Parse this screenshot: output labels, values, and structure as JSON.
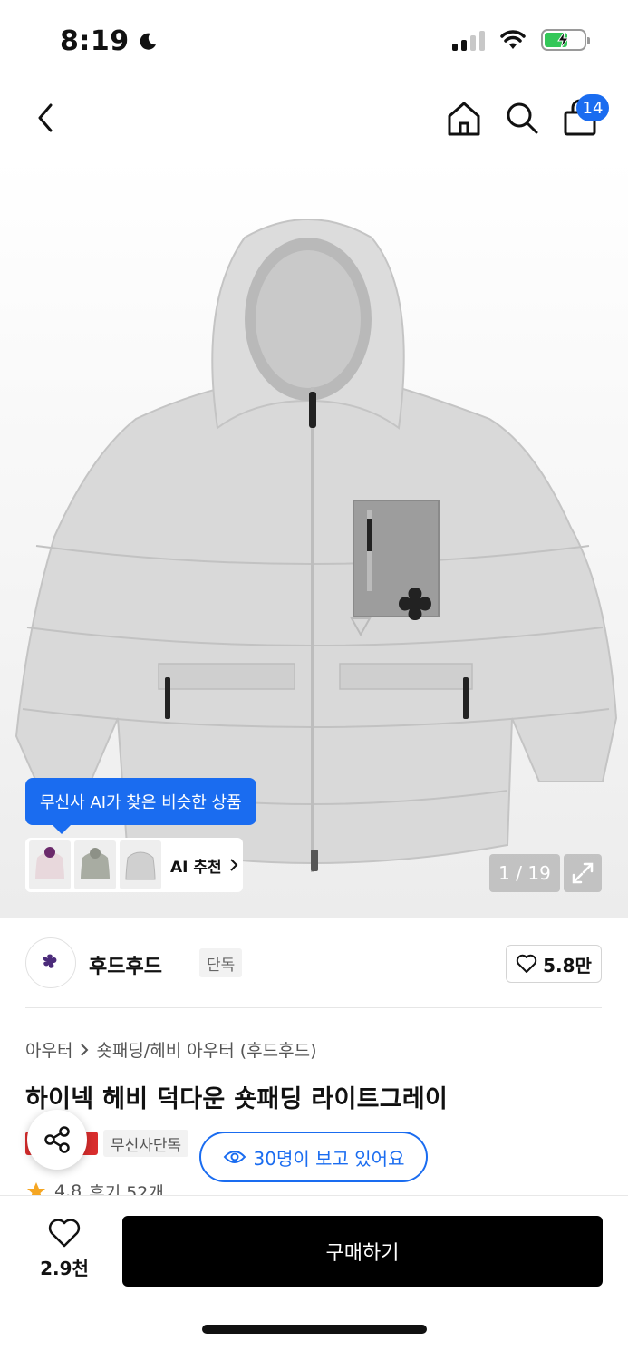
{
  "status_bar": {
    "time": "8:19",
    "moon_icon": "moon-icon",
    "wifi_icon": "wifi-icon",
    "battery_icon": "battery-charging-icon"
  },
  "top_nav": {
    "back_icon": "chevron-left-icon",
    "home_icon": "home-icon",
    "search_icon": "search-icon",
    "cart_icon": "shopping-bag-icon",
    "cart_count": "14"
  },
  "gallery": {
    "ai_tooltip": "무신사 AI가 찾은 비슷한 상품",
    "ai_reco_label": "AI 추천",
    "page_counter": "1 / 19"
  },
  "brand": {
    "name": "후드후드",
    "tag": "단독",
    "likes": "5.8만"
  },
  "product": {
    "breadcrumb": [
      "아우터",
      "숏패딩/헤비 아우터 (후드후드)"
    ],
    "title": "하이넥 헤비 덕다운 숏패딩 라이트그레이",
    "exclusive_badge": "무신사단독",
    "viewers": "30명이 보고 있어요",
    "rating": "4.8",
    "reviews": "후기 52개"
  },
  "bottom_bar": {
    "wish_count": "2.9천",
    "buy_label": "구매하기"
  },
  "colors": {
    "accent": "#1a6cf0",
    "buy_button": "#000000",
    "badge_red": "#d92d2d"
  }
}
